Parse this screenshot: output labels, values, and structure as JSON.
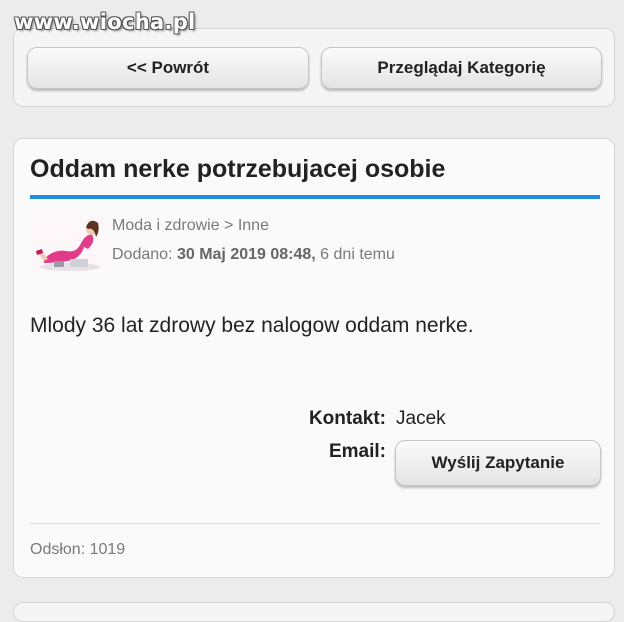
{
  "watermark": "www.wiocha.pl",
  "nav": {
    "back_label": "<< Powrót",
    "browse_label": "Przeglądaj Kategorię"
  },
  "listing": {
    "title": "Oddam nerke potrzebujacej osobie",
    "category": "Moda i zdrowie > Inne",
    "added_label": "Dodano:",
    "added_date": "30 Maj 2019 08:48,",
    "added_relative": "6 dni temu",
    "description": "Mlody 36 lat zdrowy bez nalogow oddam nerke.",
    "contact_label": "Kontakt:",
    "contact_name": "Jacek",
    "email_label": "Email:",
    "send_button": "Wyślij Zapytanie",
    "views": "Odsłon: 1019"
  },
  "colors": {
    "accent_rule": "#1e8fe0",
    "background": "#ececec"
  }
}
